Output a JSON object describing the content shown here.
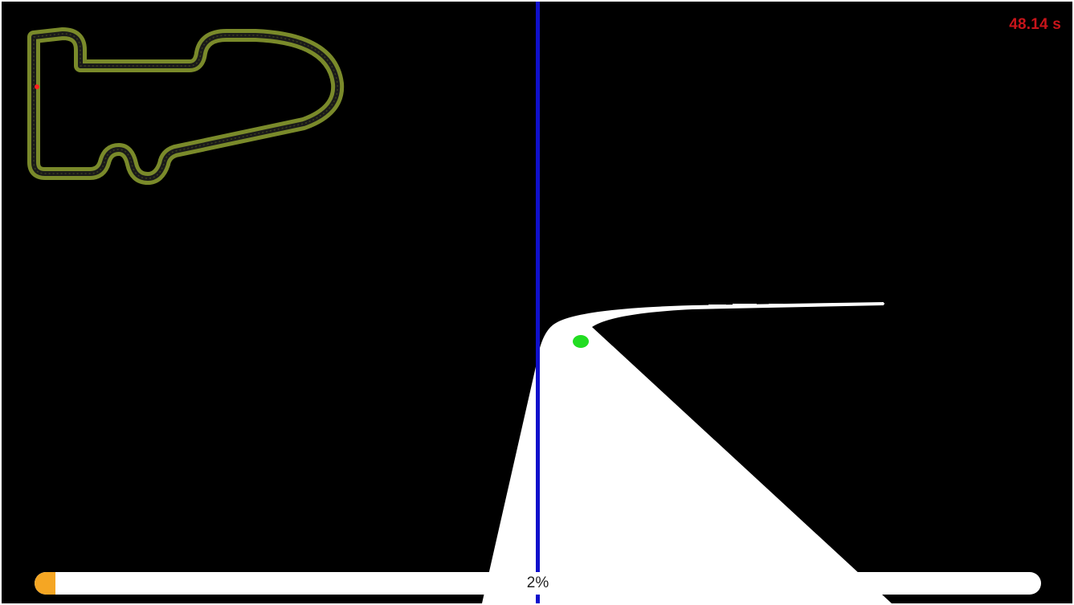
{
  "hud": {
    "timer_text": "48.14 s"
  },
  "progress": {
    "value": 0.02,
    "label": "2%"
  },
  "colors": {
    "background": "#000000",
    "track_outline": "#7a8a2a",
    "track_inner": "#1a1a1a",
    "road": "#ffffff",
    "guide_line": "#1010cc",
    "target_dot": "#22dd22",
    "car_marker": "#ff2020",
    "timer": "#c8141a",
    "progress_fill": "#f5a623"
  }
}
